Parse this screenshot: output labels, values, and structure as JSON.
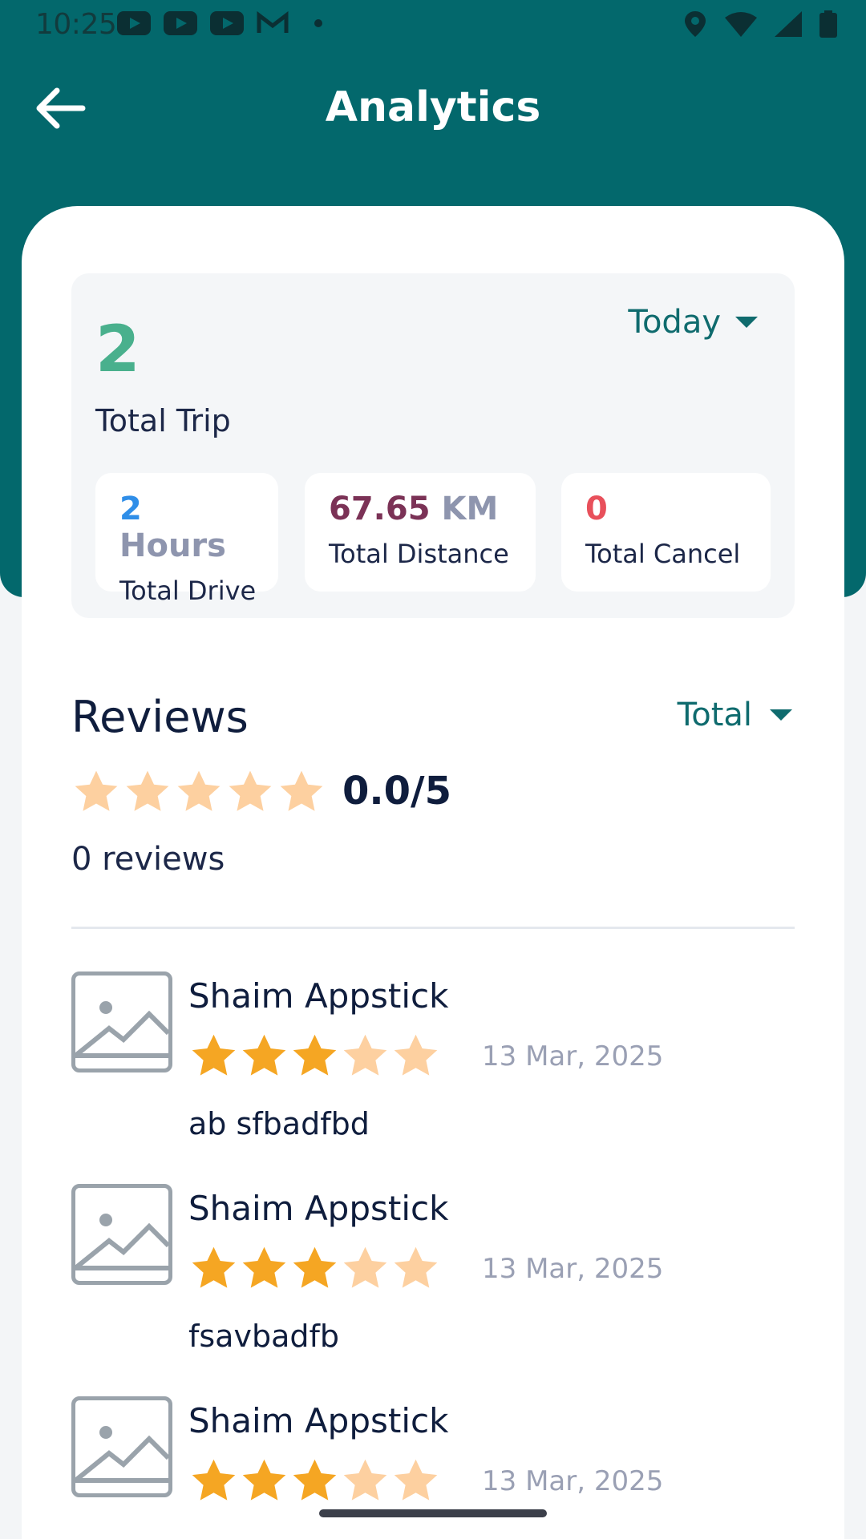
{
  "status_bar": {
    "time": "10:25",
    "left_icons": [
      "youtube-icon",
      "youtube-icon",
      "youtube-icon",
      "gmail-icon",
      "notification-dot-icon"
    ],
    "right_icons": [
      "location-icon",
      "wifi-icon",
      "signal-icon",
      "battery-icon"
    ]
  },
  "header": {
    "title": "Analytics",
    "back_icon": "back-arrow-icon",
    "color": "#03686c"
  },
  "summary": {
    "trip_count": "2",
    "trip_label": "Total Trip",
    "period_selected": "Today",
    "stats": {
      "drive_value": "2",
      "drive_unit": "Hours",
      "drive_label": "Total Drive",
      "distance_value": "67.65",
      "distance_unit": "KM",
      "distance_label": "Total Distance",
      "cancel_value": "0",
      "cancel_label": "Total Cancel"
    },
    "colors": {
      "trip": "#49b08d",
      "drive": "#2f8ee8",
      "distance": "#7b3256",
      "cancel": "#e8505b"
    }
  },
  "reviews": {
    "title": "Reviews",
    "filter_selected": "Total",
    "rating_value": 0,
    "rating_text": "0.0/5",
    "count_text": "0 reviews",
    "star_filled_color": "#f5a623",
    "star_empty_color": "#fdd0a0",
    "items": [
      {
        "name": "Shaim Appstick",
        "rating": 3,
        "date": "13 Mar, 2025",
        "text": "ab sfbadfbd"
      },
      {
        "name": "Shaim Appstick",
        "rating": 3,
        "date": "13 Mar, 2025",
        "text": "fsavbadfb"
      },
      {
        "name": "Shaim Appstick",
        "rating": 3,
        "date": "13 Mar, 2025",
        "text": ""
      }
    ]
  }
}
